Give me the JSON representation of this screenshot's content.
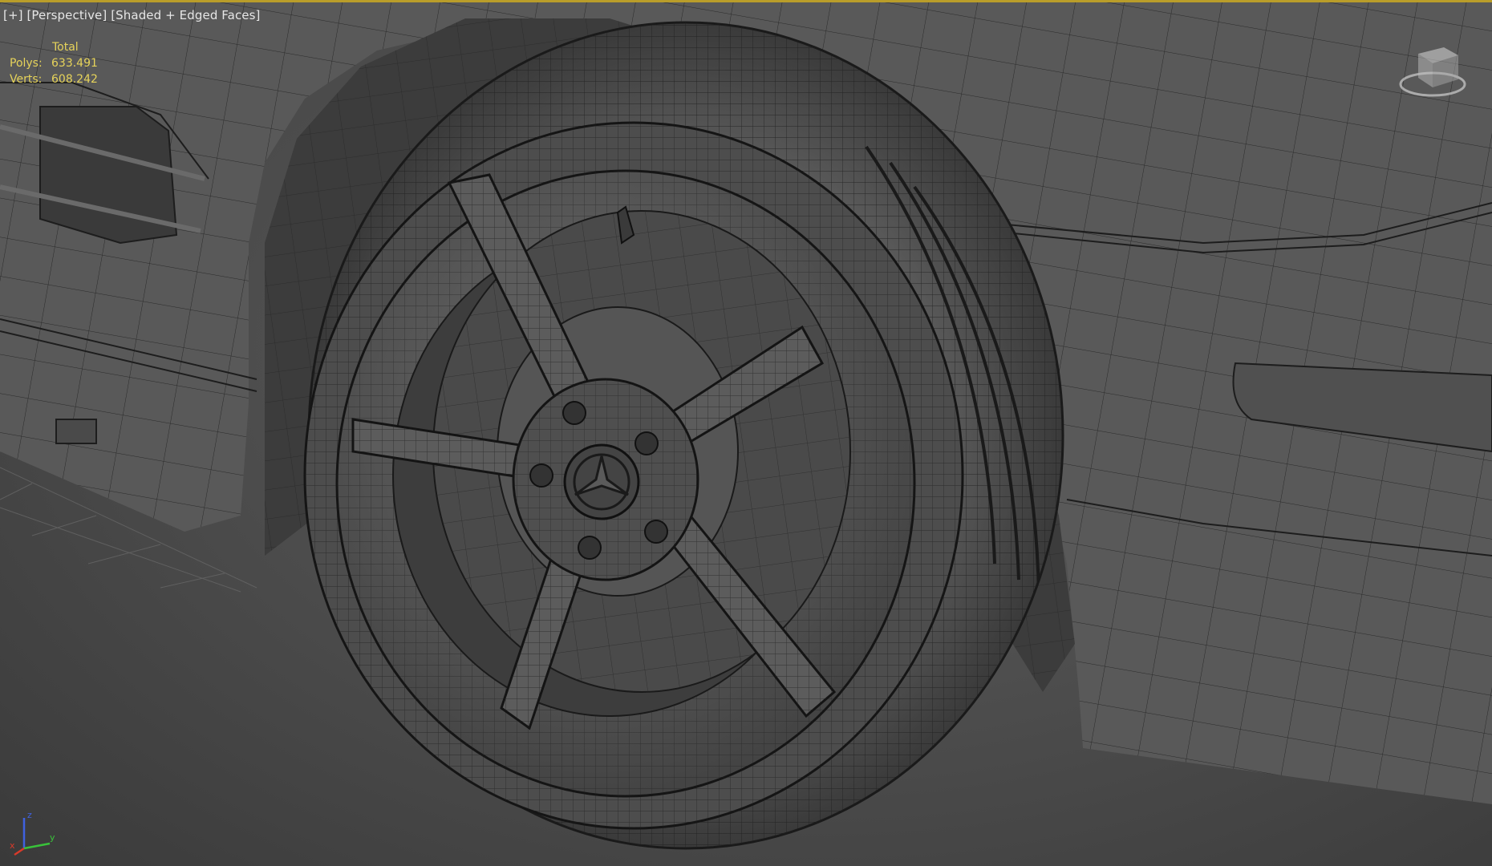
{
  "viewport": {
    "menu": "[+]",
    "view": "[Perspective]",
    "shading": "[Shaded + Edged Faces]"
  },
  "stats": {
    "header": "Total",
    "polys_label": "Polys:",
    "polys_value": "633.491",
    "verts_label": "Verts:",
    "verts_value": "608.242"
  },
  "axes": {
    "x": "x",
    "y": "y",
    "z": "z"
  },
  "colors": {
    "active_border": "#b99d2a",
    "stats_text": "#e6d35a",
    "label_text": "#e6e6e6",
    "axis_x": "#d83a2a",
    "axis_y": "#39c23a",
    "axis_z": "#3f61e0"
  },
  "icons": [
    "viewcube-icon",
    "axis-tripod-icon"
  ]
}
